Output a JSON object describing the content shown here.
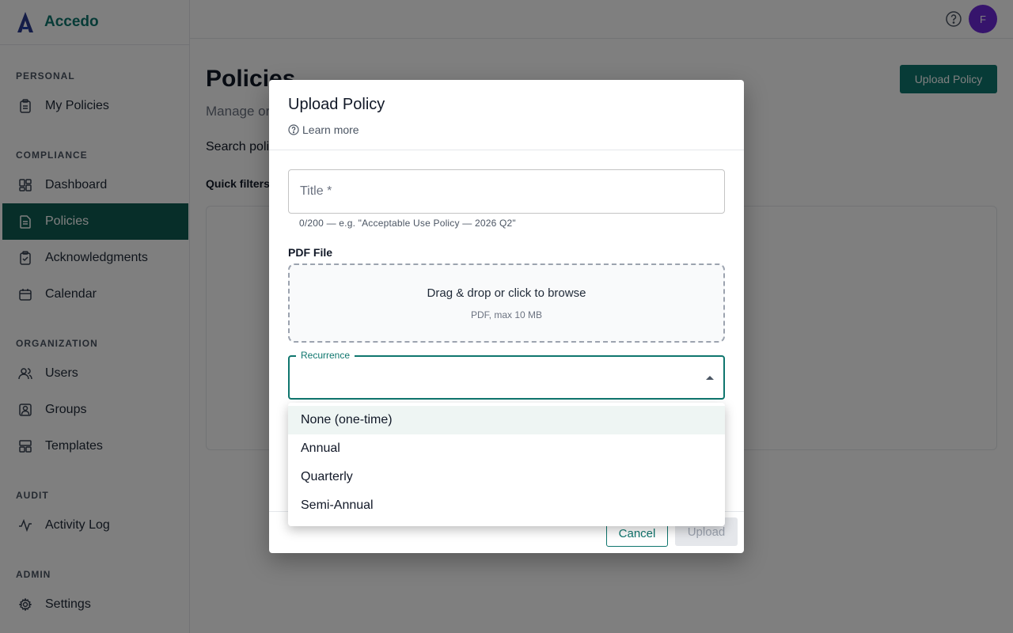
{
  "brand": {
    "name": "Accedo"
  },
  "sidebar": {
    "sections": [
      {
        "title": "PERSONAL",
        "items": [
          {
            "label": "My Policies",
            "icon": "clipboard-icon"
          }
        ]
      },
      {
        "title": "COMPLIANCE",
        "items": [
          {
            "label": "Dashboard",
            "icon": "dashboard-icon"
          },
          {
            "label": "Policies",
            "icon": "document-icon",
            "active": true
          },
          {
            "label": "Acknowledgments",
            "icon": "clipboard-check-icon"
          },
          {
            "label": "Calendar",
            "icon": "calendar-icon"
          }
        ]
      },
      {
        "title": "ORGANIZATION",
        "items": [
          {
            "label": "Users",
            "icon": "users-icon"
          },
          {
            "label": "Groups",
            "icon": "group-icon"
          },
          {
            "label": "Templates",
            "icon": "templates-icon"
          }
        ]
      },
      {
        "title": "AUDIT",
        "items": [
          {
            "label": "Activity Log",
            "icon": "activity-icon"
          }
        ]
      },
      {
        "title": "ADMIN",
        "items": [
          {
            "label": "Settings",
            "icon": "gear-icon"
          }
        ]
      }
    ]
  },
  "topbar": {
    "avatar_initial": "F"
  },
  "page": {
    "title": "Policies",
    "subtitle": "Manage org",
    "upload_button": "Upload Policy",
    "search_label": "Search poli",
    "quick_filters": "Quick filters"
  },
  "modal": {
    "title": "Upload Policy",
    "learn_more": "Learn more",
    "title_field": {
      "placeholder": "Title *",
      "helper": "0/200 — e.g. \"Acceptable Use Policy — 2026 Q2\""
    },
    "pdf_label": "PDF File",
    "dropzone": {
      "main": "Drag & drop or click to browse",
      "sub": "PDF, max 10 MB"
    },
    "recurrence": {
      "label": "Recurrence",
      "value": ""
    },
    "cancel": "Cancel",
    "upload": "Upload"
  },
  "menu": {
    "options": [
      "None (one-time)",
      "Annual",
      "Quarterly",
      "Semi-Annual"
    ],
    "highlighted_index": 0
  },
  "colors": {
    "accent": "#0f766e",
    "active_nav": "#0f5c52",
    "avatar": "#6d28d9"
  }
}
